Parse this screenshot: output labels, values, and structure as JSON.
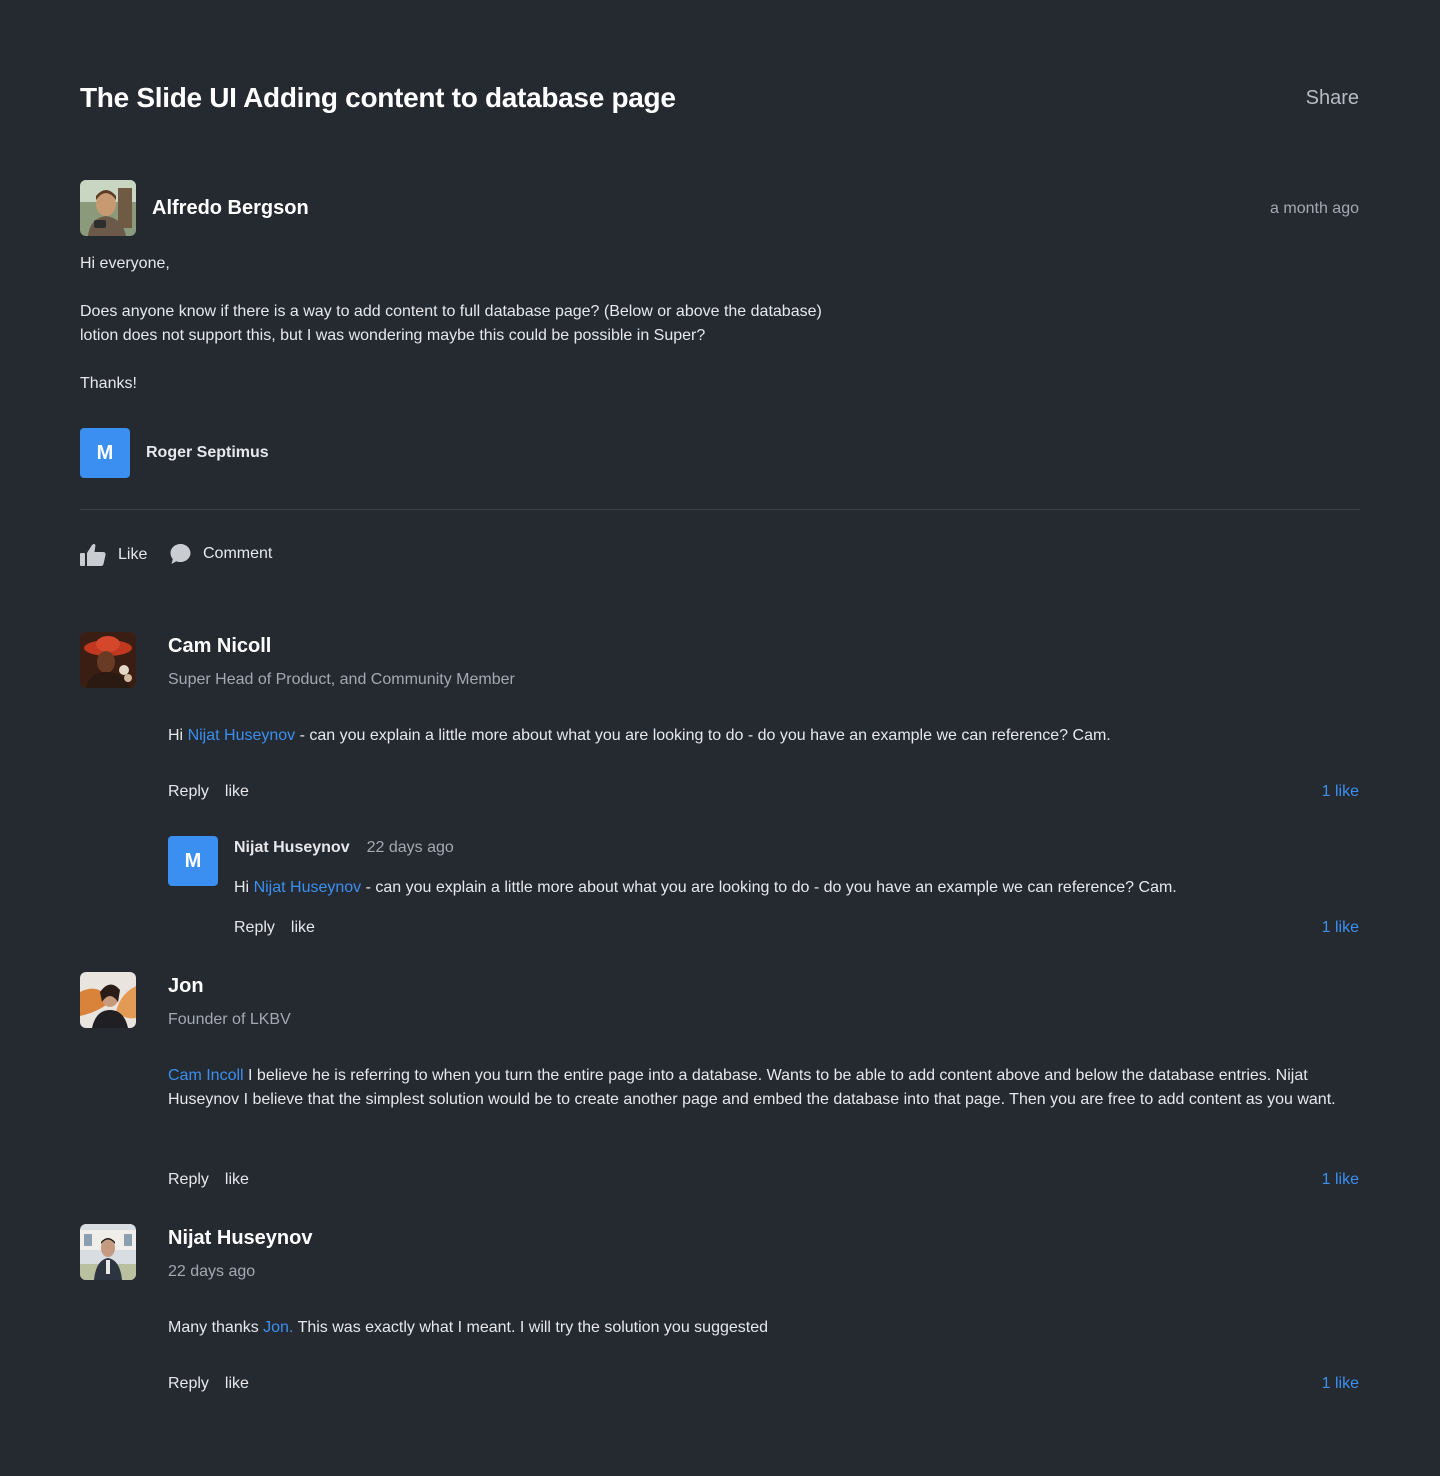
{
  "page": {
    "title": "The Slide UI Adding content to database page",
    "share_label": "Share"
  },
  "post": {
    "author": "Alfredo Bergson",
    "time": "a month ago",
    "greeting": "Hi everyone,",
    "line1": "Does anyone know if there is a way to add content to full database page? (Below or above the database)",
    "line2": "lotion does not support this, but I was wondering maybe this could be possible in Super?",
    "thanks": "Thanks!",
    "tagged": {
      "initial": "M",
      "name": "Roger Septimus"
    }
  },
  "actions": {
    "like_label": "Like",
    "comment_label": "Comment"
  },
  "comments": [
    {
      "author": "Cam Nicoll",
      "role": "Super Head of Product, and Community Member",
      "text_pre": "Hi ",
      "mention": "Nijat Huseynov",
      "text_post": " - can you explain a little more about what you are looking to do - do you have an example we can reference? Cam.",
      "reply_label": "Reply",
      "like_label": "like",
      "likes": "1 like",
      "reply": {
        "initial": "M",
        "author": "Nijat Huseynov",
        "time": "22 days ago",
        "text_pre": "Hi ",
        "mention": "Nijat Huseynov",
        "text_post": " - can you explain a little more about what you are looking to do - do you have an example we can reference? Cam.",
        "reply_label": "Reply",
        "like_label": "like",
        "likes": "1 like"
      }
    },
    {
      "author": "Jon",
      "role": "Founder of LKBV",
      "mention": "Cam Incoll",
      "text_post": " I believe he is referring to when you turn the entire page into a database. Wants to be able to add content above and below the database entries. Nijat Huseynov I believe that the simplest solution would be to create another page and embed the database into that page. Then you are free to add content as you want.",
      "reply_label": "Reply",
      "like_label": "like",
      "likes": "1 like"
    },
    {
      "author": "Nijat Huseynov",
      "role": "22 days ago",
      "text_pre": "Many thanks ",
      "mention": "Jon.",
      "text_post": " This was exactly what I meant. I will try the solution you suggested",
      "reply_label": "Reply",
      "like_label": "like",
      "likes": "1 like"
    }
  ],
  "colors": {
    "background": "#252a31",
    "accent": "#3b8ff0",
    "muted": "#a3a9b2"
  }
}
